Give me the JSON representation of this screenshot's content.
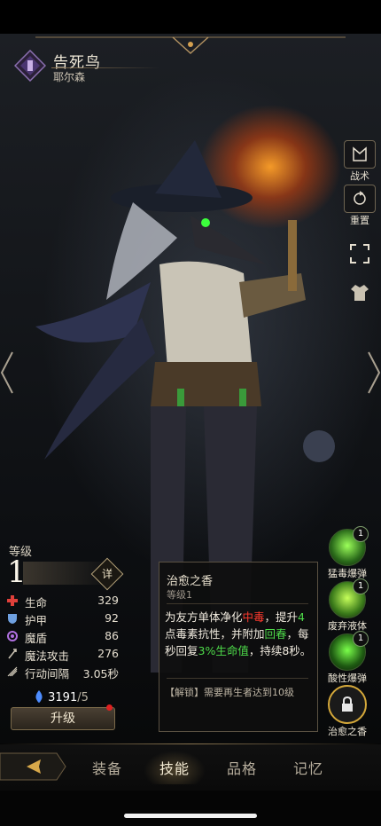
{
  "hero": {
    "name": "告死鸟",
    "subtitle": "耶尔森"
  },
  "side_buttons": [
    {
      "label": "战术",
      "icon": "tactics-icon"
    },
    {
      "label": "重置",
      "icon": "reset-icon"
    },
    {
      "label": "",
      "icon": "fullscreen-icon"
    },
    {
      "label": "",
      "icon": "outfit-icon"
    }
  ],
  "level": {
    "label": "等级",
    "value": "1",
    "detail_label": "详"
  },
  "stats": [
    {
      "label": "生命",
      "value": "329",
      "icon": "health-icon",
      "color": "#e0403a"
    },
    {
      "label": "护甲",
      "value": "92",
      "icon": "armor-icon",
      "color": "#6fa0e0"
    },
    {
      "label": "魔盾",
      "value": "86",
      "icon": "magic-shield-icon",
      "color": "#b070e0"
    },
    {
      "label": "魔法攻击",
      "value": "276",
      "icon": "magic-attack-icon",
      "color": "#c9c2b2"
    },
    {
      "label": "行动间隔",
      "value": "3.05秒",
      "icon": "action-interval-icon",
      "color": "#c9c2b2"
    }
  ],
  "currency": {
    "amount": "3191",
    "max": "/5"
  },
  "upgrade_label": "升级",
  "skill_detail": {
    "title": "治愈之香",
    "level": "等级1",
    "desc_1": "为友方单体净化",
    "desc_poison": "中毒",
    "desc_2": "，提升",
    "desc_num": "4",
    "desc_3": "点毒素抗性，并附加",
    "desc_regen": "回春",
    "desc_4": "，每秒回复",
    "desc_pct": "3%生命值",
    "desc_5": "，持续8秒。",
    "unlock": "【解锁】需要再生者达到10级"
  },
  "skills": [
    {
      "name": "猛毒爆弹",
      "level": "1"
    },
    {
      "name": "废弃液体",
      "level": "1"
    },
    {
      "name": "酸性爆弹",
      "level": "1"
    },
    {
      "name": "治愈之香",
      "level": ""
    }
  ],
  "tabs": [
    "装备",
    "技能",
    "品格",
    "记忆"
  ],
  "active_tab": "技能"
}
